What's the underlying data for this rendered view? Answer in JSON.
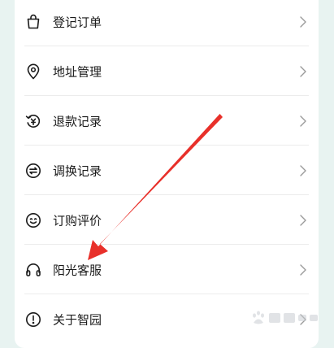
{
  "menu": {
    "items": [
      {
        "label": "登记订单",
        "icon": "shopping-bag-icon"
      },
      {
        "label": "地址管理",
        "icon": "location-pin-icon"
      },
      {
        "label": "退款记录",
        "icon": "refund-icon"
      },
      {
        "label": "调换记录",
        "icon": "exchange-icon"
      },
      {
        "label": "订购评价",
        "icon": "smiley-icon"
      },
      {
        "label": "阳光客服",
        "icon": "headset-icon"
      },
      {
        "label": "关于智园",
        "icon": "info-icon"
      }
    ]
  },
  "colors": {
    "background": "#e8f3f1",
    "card": "#ffffff",
    "text": "#1b1b1b",
    "chevron": "#9a9a9a",
    "annotation_arrow": "#e8302a"
  }
}
